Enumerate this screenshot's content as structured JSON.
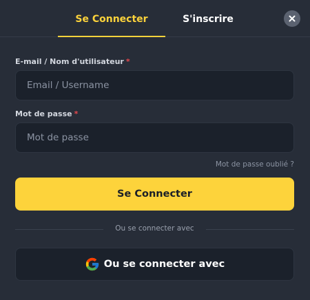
{
  "tabs": {
    "login_label": "Se Connecter",
    "register_label": "S'inscrire"
  },
  "form": {
    "email_label": "E-mail / Nom d'utilisateur",
    "email_required": "*",
    "email_placeholder": "Email / Username",
    "password_label": "Mot de passe",
    "password_required": "*",
    "password_placeholder": "Mot de passe",
    "forgot_label": "Mot de passe oublié ?"
  },
  "actions": {
    "submit_label": "Se Connecter",
    "divider_label": "Ou se connecter avec",
    "google_label": "Ou se connecter avec"
  },
  "icons": {
    "close": "close-icon",
    "google": "google-icon"
  },
  "colors": {
    "accent": "#fdd33b",
    "background": "#272d38",
    "field_background": "#1b212b",
    "required": "#e5484d"
  }
}
